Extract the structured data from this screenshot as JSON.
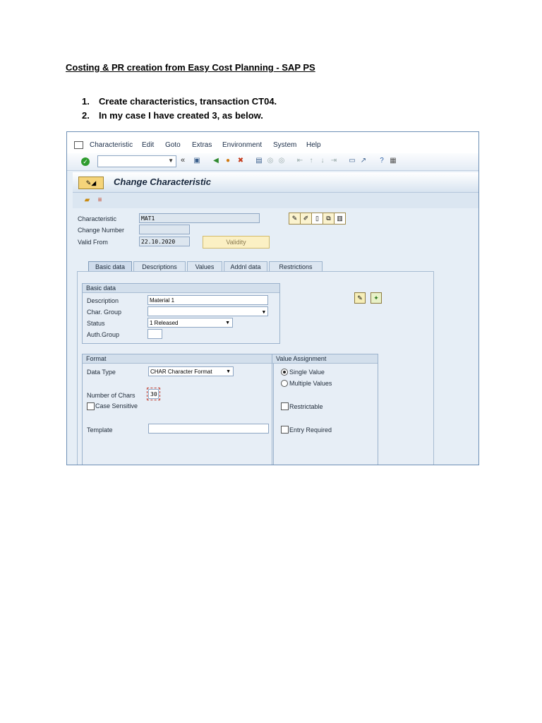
{
  "doc": {
    "title": "Costing & PR creation from Easy Cost Planning - SAP PS",
    "steps": [
      {
        "num": "1.",
        "text": "Create characteristics, transaction CT04."
      },
      {
        "num": "2.",
        "text": "In my case I have created 3, as below."
      }
    ]
  },
  "sap": {
    "menu": [
      "Characteristic",
      "Edit",
      "Goto",
      "Extras",
      "Environment",
      "System",
      "Help"
    ],
    "toolbar": {
      "command_value": "",
      "icons": [
        "save-icon",
        "back-icon",
        "exit-icon",
        "cancel-icon",
        "print-icon",
        "find-icon",
        "find-next-icon",
        "first-page-icon",
        "previous-page-icon",
        "next-page-icon",
        "last-page-icon",
        "create-session-icon",
        "shortcut-icon",
        "help-icon",
        "customize-layout-icon"
      ]
    },
    "screen_title": "Change Characteristic",
    "header": {
      "characteristic_label": "Characteristic",
      "characteristic_value": "MAT1",
      "change_number_label": "Change Number",
      "change_number_value": "",
      "valid_from_label": "Valid From",
      "valid_from_value": "22.10.2020",
      "validity_button": "Validity"
    },
    "tabs": [
      "Basic data",
      "Descriptions",
      "Values",
      "Addnl data",
      "Restrictions"
    ],
    "basic_data": {
      "title": "Basic data",
      "description_label": "Description",
      "description_value": "Material 1",
      "char_group_label": "Char. Group",
      "char_group_value": "",
      "status_label": "Status",
      "status_value": "1 Released",
      "auth_group_label": "Auth.Group",
      "auth_group_value": ""
    },
    "format": {
      "title": "Format",
      "data_type_label": "Data Type",
      "data_type_value": "CHAR Character Format",
      "num_chars_label": "Number of Chars",
      "num_chars_value": "30",
      "case_sensitive_label": "Case Sensitive",
      "template_label": "Template",
      "template_value": ""
    },
    "value_assignment": {
      "title": "Value Assignment",
      "single_value": "Single Value",
      "multiple_values": "Multiple Values",
      "restrictable": "Restrictable",
      "entry_required": "Entry Required"
    }
  }
}
